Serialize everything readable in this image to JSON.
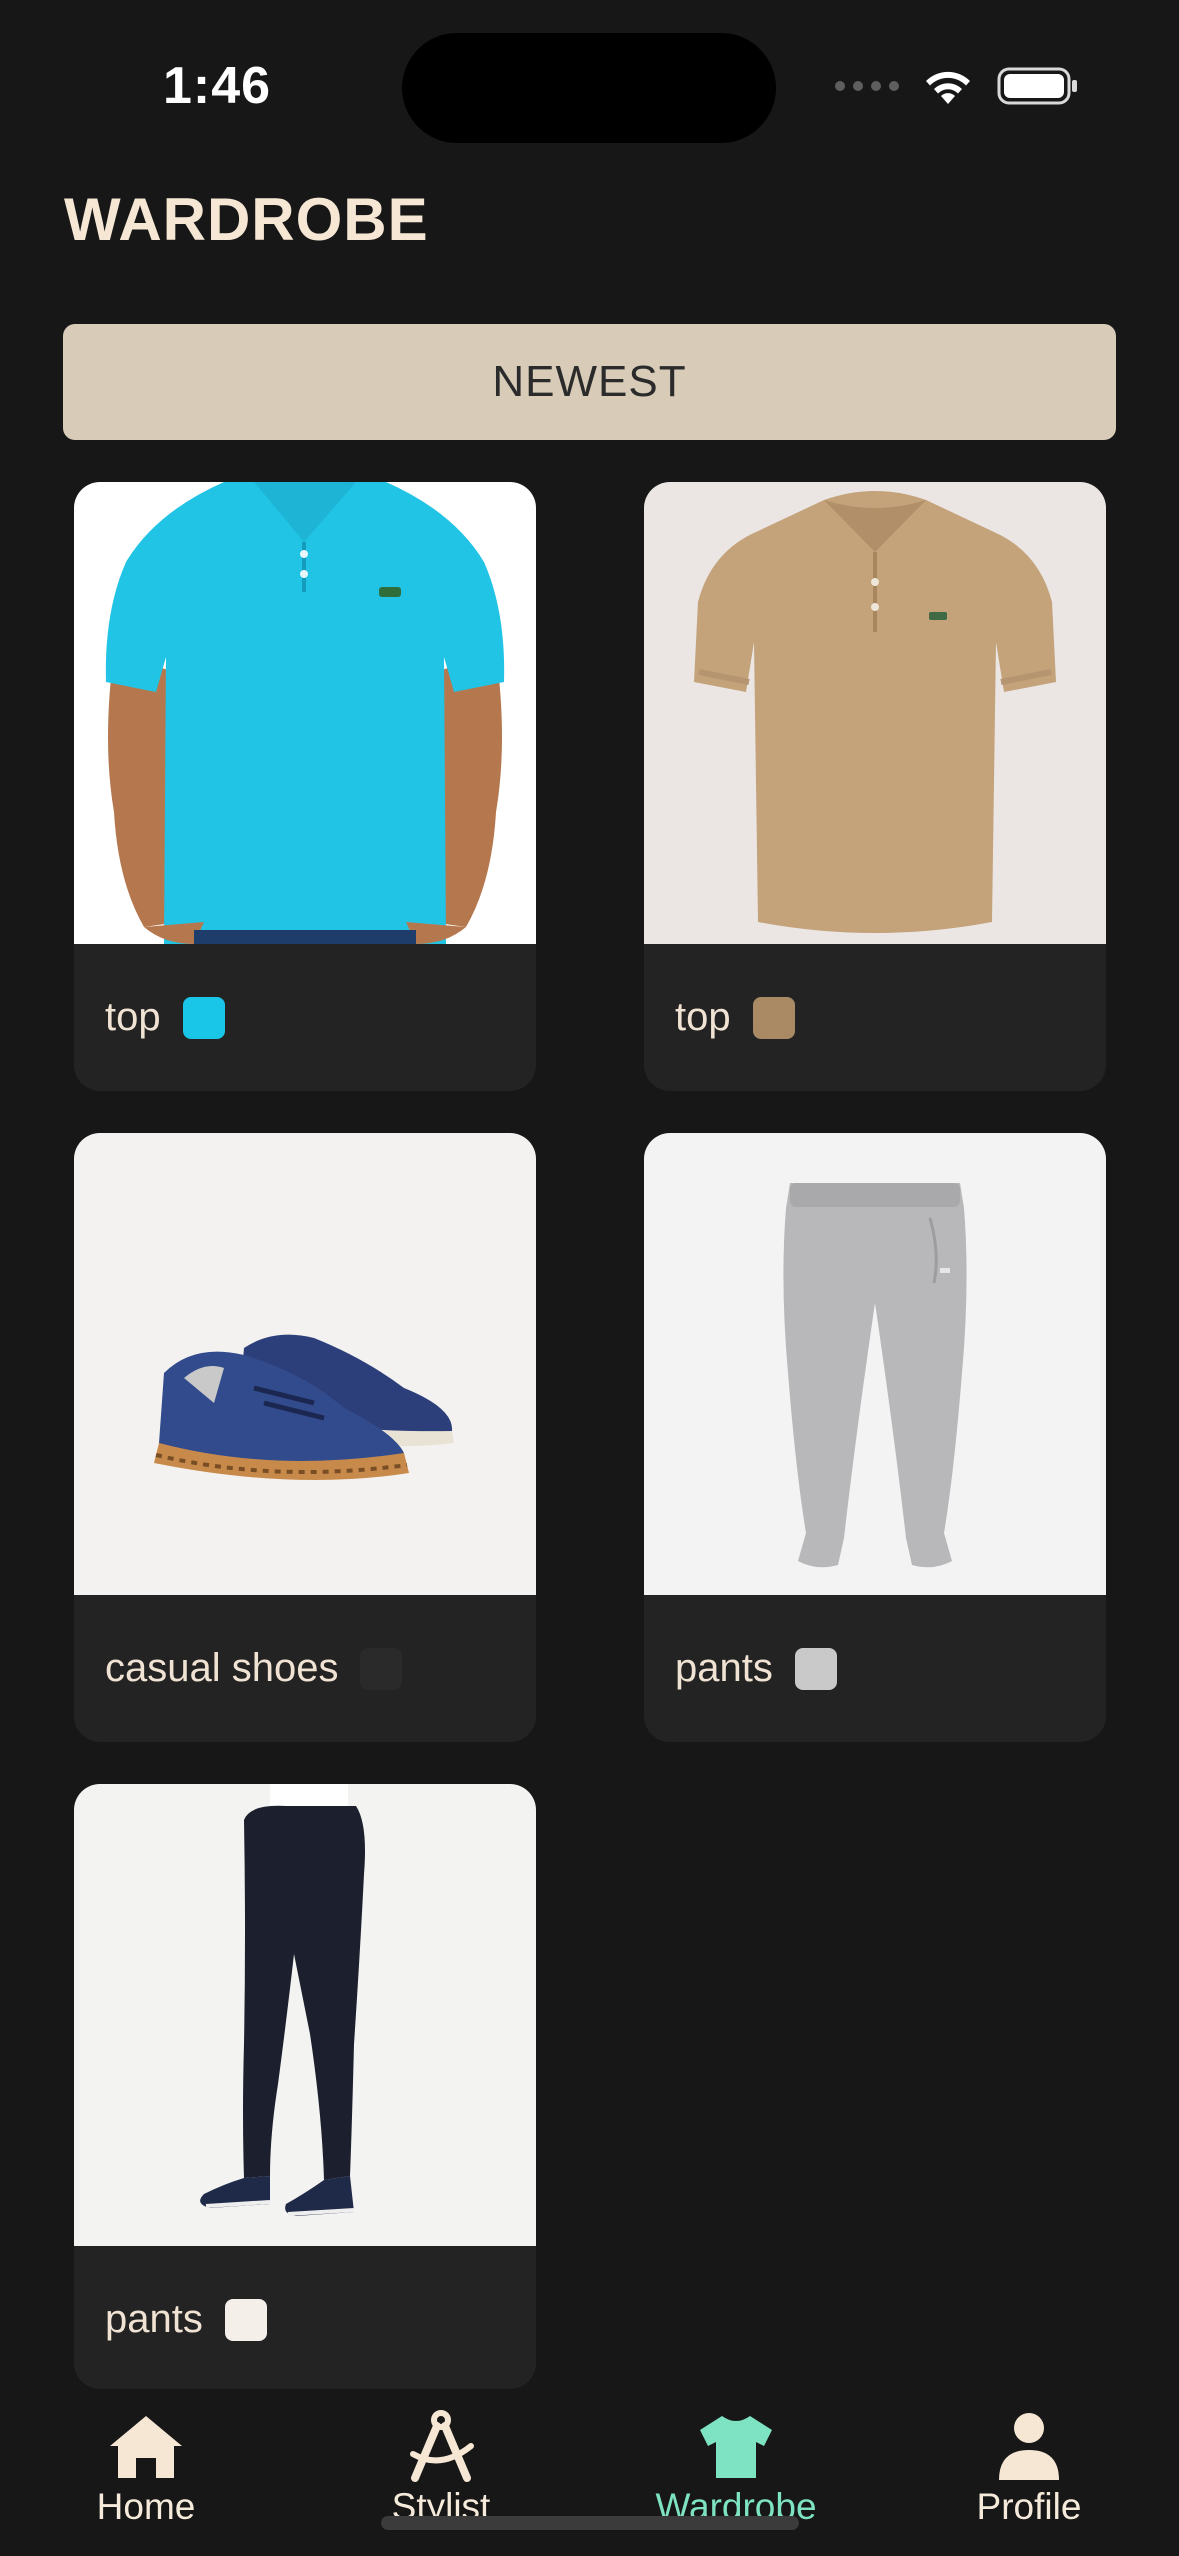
{
  "status": {
    "time": "1:46"
  },
  "header": {
    "title": "WARDROBE"
  },
  "sort": {
    "label": "NEWEST"
  },
  "items": [
    {
      "label": "top",
      "color": "#19C6E8",
      "icon": "cyan-polo-shirt"
    },
    {
      "label": "top",
      "color": "#A98A64",
      "icon": "tan-polo-shirt"
    },
    {
      "label": "casual shoes",
      "color": "#2A2A2A",
      "icon": "navy-sneakers"
    },
    {
      "label": "pants",
      "color": "#C9C9C9",
      "icon": "grey-sweatpants"
    },
    {
      "label": "pants",
      "color": "#F4EFE8",
      "icon": "navy-chino-pants"
    }
  ],
  "tabs": [
    {
      "label": "Home",
      "icon": "home-icon"
    },
    {
      "label": "Stylist",
      "icon": "compass-icon"
    },
    {
      "label": "Wardrobe",
      "icon": "tshirt-icon",
      "active": true
    },
    {
      "label": "Profile",
      "icon": "person-icon"
    }
  ],
  "colors": {
    "background": "#171717",
    "accent": "#7DE3C2",
    "sort_button": "#D8CCB9",
    "title": "#F6E7D5"
  }
}
